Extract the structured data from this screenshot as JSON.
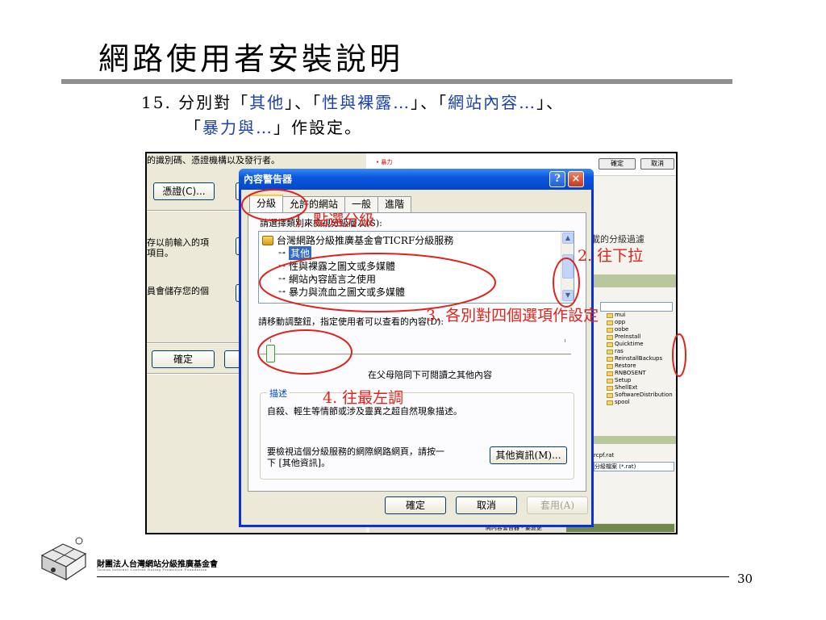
{
  "slide": {
    "title": "網路使用者安裝說明",
    "instruction": {
      "number": "15.",
      "prefix": "分別對「",
      "item1": "其他",
      "sep1": "」、「",
      "item2": "性與裸露…",
      "sep2": "」、「",
      "item3": "網站內容…",
      "sep3": "」、",
      "open4": "「",
      "item4": "暴力與…",
      "suffix": "」作設定。"
    },
    "page_number": "30"
  },
  "background_left": {
    "top_text": "的識別碼、憑證機構以及發行者。",
    "cert_button": "憑證(C)...",
    "text_a1": "存以前輸入的項",
    "text_a2": "項目。",
    "text_b": "員會儲存您的個",
    "ok_button": "確定"
  },
  "background_right": {
    "violence_tag": "• 暴力",
    "ok_small": "確定",
    "cancel_small": "取消",
    "download_text": "下載的分級過濾",
    "folders": [
      "mui",
      "opp",
      "oobe",
      "PreInstall",
      "Quicktime",
      "ras",
      "ReinstallBackups",
      "Restore",
      "RNBOSENT",
      "Setup",
      "ShellExt",
      "SoftwareDistribution",
      "spool"
    ],
    "file_text": "rcpf.rat",
    "filter_text": "分級檔案 (*.rat)",
    "status_text": "開內容警告器 - 要變更"
  },
  "dialog": {
    "title": "內容警告器",
    "help_icon": "?",
    "close_icon": "×",
    "tabs": [
      "分級",
      "允許的網站",
      "一般",
      "進階"
    ],
    "category_label": "請選擇類別來檢視分級層次(S):",
    "tree_root": "台灣網路分級推廣基金會TICRF分級服務",
    "tree_items": [
      "其他",
      "性與裸露之圖文或多媒體",
      "網站內容語言之使用",
      "暴力與流血之圖文或多媒體"
    ],
    "slider_label": "請移動調整鈕，指定使用者可以查看的內容(D):",
    "slider_value": "在父母陪同下可閱讀之其他內容",
    "desc_legend": "描述",
    "desc_text": "自殺、輕生等情節或涉及靈異之超自然現象描述。",
    "more_info_text1": "要檢視這個分級服務的網際網路網頁，請按一",
    "more_info_text2": "下 [其他資訊]。",
    "more_info_button": "其他資訊(M)...",
    "ok_button": "確定",
    "cancel_button": "取消",
    "apply_button": "套用(A)"
  },
  "annotations": {
    "a1": "1. 點選分級",
    "a2": "2. 往下拉",
    "a3": "3. 各別對四個選項作設定",
    "a4": "4. 往最左調",
    "color": "#e0231b"
  },
  "footer": {
    "org_name": "財團法人台灣網站分級推廣基金會",
    "org_en": "Taiwan Internet Content Rating Promotion Foundation"
  }
}
